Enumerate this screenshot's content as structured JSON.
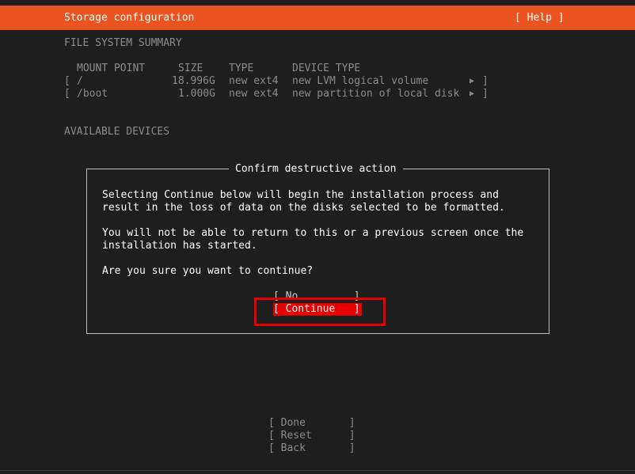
{
  "header": {
    "title": "Storage configuration",
    "help_label": "[ Help ]"
  },
  "summary": {
    "heading": "FILE SYSTEM SUMMARY",
    "columns": {
      "mount_point": "MOUNT POINT",
      "size": "SIZE",
      "type": "TYPE",
      "device_type": "DEVICE TYPE"
    },
    "rows": [
      {
        "open": "[",
        "mount_point": "/",
        "size": "18.996G",
        "type": "new ext4",
        "device_type": "new LVM logical volume",
        "arrow": "▶",
        "close": "]"
      },
      {
        "open": "[",
        "mount_point": "/boot",
        "size": "1.000G",
        "type": "new ext4",
        "device_type": "new partition of local disk",
        "arrow": "▶",
        "close": "]"
      }
    ]
  },
  "available": {
    "heading": "AVAILABLE DEVICES"
  },
  "dialog": {
    "title": "Confirm destructive action",
    "line1": "Selecting Continue below will begin the installation process and",
    "line2": "result in the loss of data on the disks selected to be formatted.",
    "line3": "You will not be able to return to this or a previous screen once the",
    "line4": "installation has started.",
    "question": "Are you sure you want to continue?",
    "no_label": "[ No         ]",
    "continue_label": "[ Continue   ]"
  },
  "footer": {
    "done_label": "[ Done       ]",
    "reset_label": "[ Reset      ]",
    "back_label": "[ Back       ]"
  },
  "colors": {
    "accent": "#e95420",
    "selection": "#e60000",
    "background": "#1e1e1e"
  }
}
